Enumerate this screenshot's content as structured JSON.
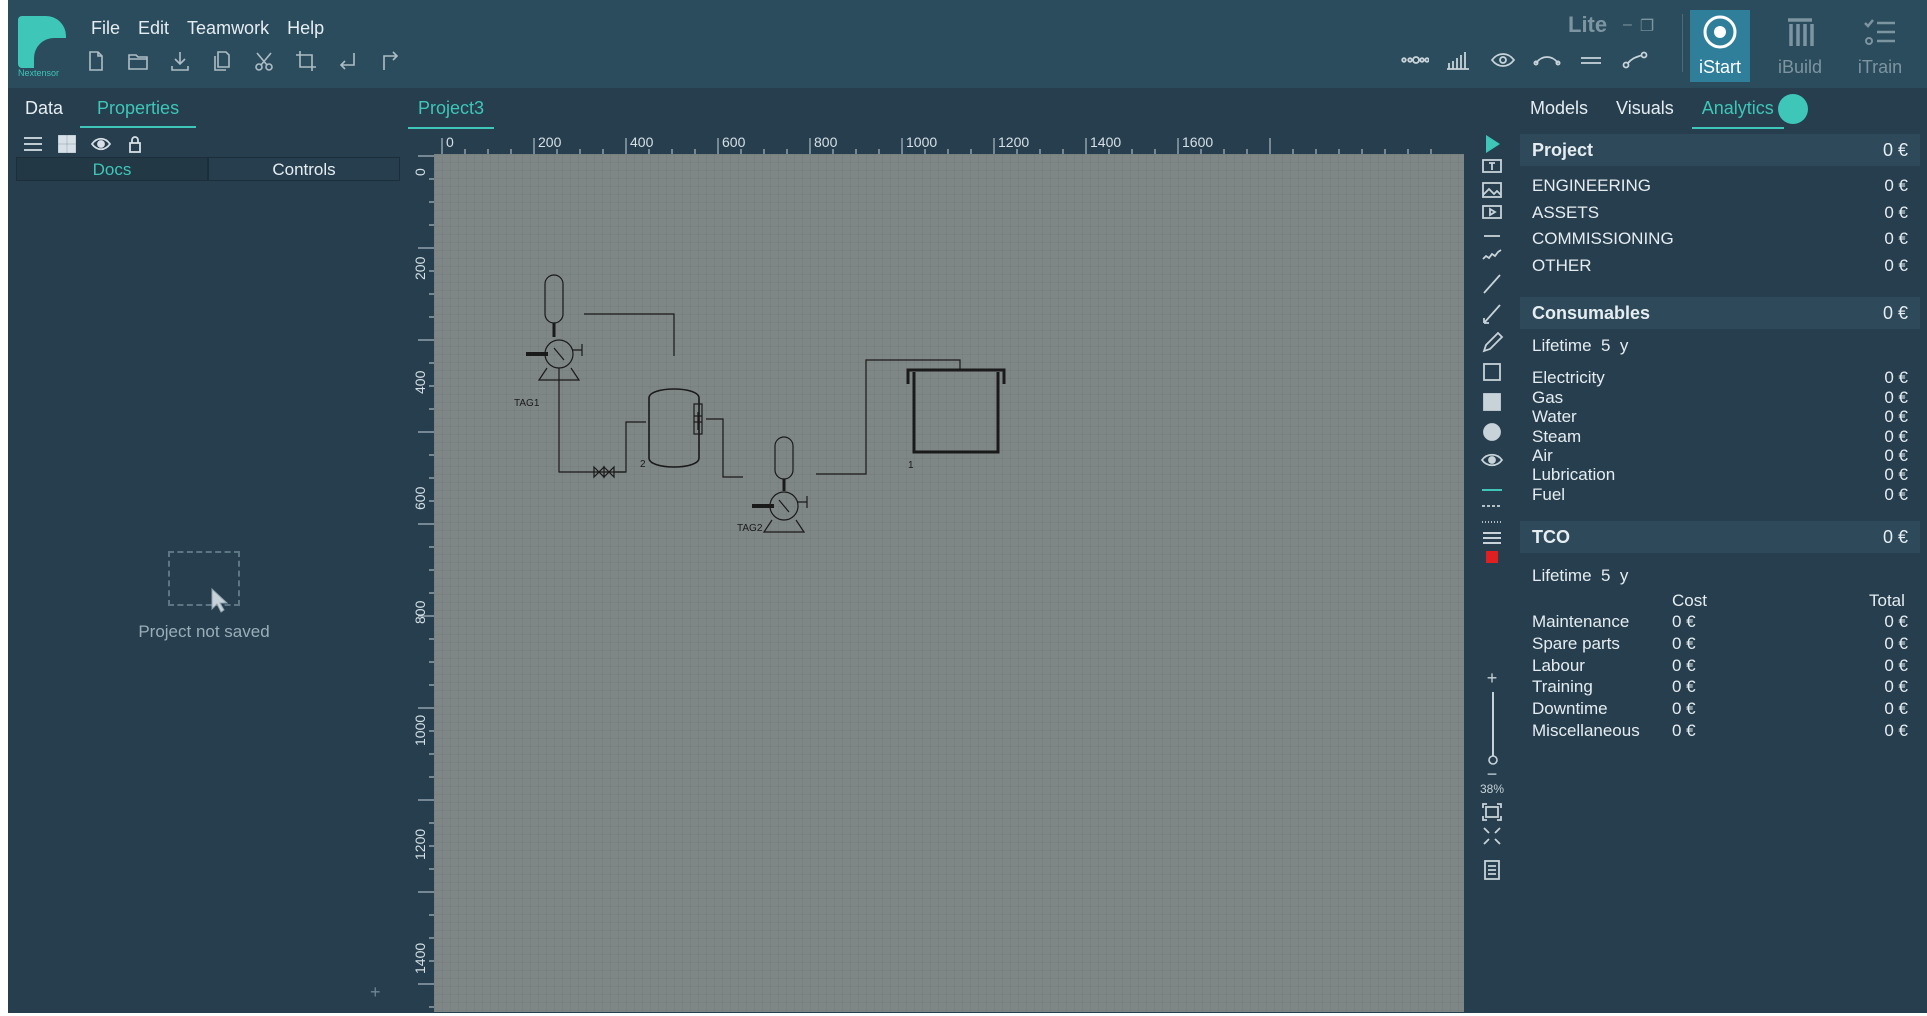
{
  "app": {
    "logo_text": "Nextensor",
    "edition": "Lite"
  },
  "menu": [
    "File",
    "Edit",
    "Teamwork",
    "Help"
  ],
  "toolbar": [
    "new-file-icon",
    "open-folder-icon",
    "download-icon",
    "copy-icon",
    "cut-icon",
    "crop-icon",
    "undo-icon",
    "redo-icon"
  ],
  "modes": [
    {
      "label": "iStart",
      "active": true
    },
    {
      "label": "iBuild",
      "active": false
    },
    {
      "label": "iTrain",
      "active": false
    }
  ],
  "left": {
    "tabs": [
      "Data",
      "Properties"
    ],
    "active_tab": "Properties",
    "subtabs": [
      "Docs",
      "Controls"
    ],
    "empty_text": "Project not saved",
    "plus": "+"
  },
  "center": {
    "doc_tab": "Project3",
    "ruler_top": [
      "0",
      "200",
      "400",
      "600",
      "800",
      "1000",
      "1200",
      "1400",
      "1600"
    ],
    "ruler_left": [
      "0",
      "200",
      "400",
      "600",
      "800",
      "1000",
      "1200",
      "1400"
    ],
    "diagram_labels": {
      "tag1": "TAG1",
      "tag2": "TAG2",
      "num2": "2",
      "num1": "1"
    },
    "zoom": "38%",
    "zoom_plus": "+",
    "zoom_minus": "−"
  },
  "right": {
    "tabs": [
      "Models",
      "Visuals",
      "Analytics"
    ],
    "active_tab": "Analytics",
    "project": {
      "title": "Project",
      "amount": "0 €",
      "rows": [
        {
          "label": "ENGINEERING",
          "amount": "0 €"
        },
        {
          "label": "ASSETS",
          "amount": "0 €"
        },
        {
          "label": "COMMISSIONING",
          "amount": "0 €"
        },
        {
          "label": "OTHER",
          "amount": "0 €"
        }
      ]
    },
    "consumables": {
      "title": "Consumables",
      "amount": "0 €",
      "lifetime": "Lifetime  5  y",
      "rows": [
        {
          "label": "Electricity",
          "amount": "0 €"
        },
        {
          "label": "Gas",
          "amount": "0 €"
        },
        {
          "label": "Water",
          "amount": "0 €"
        },
        {
          "label": "Steam",
          "amount": "0 €"
        },
        {
          "label": "Air",
          "amount": "0 €"
        },
        {
          "label": "Lubrication",
          "amount": "0 €"
        },
        {
          "label": "Fuel",
          "amount": "0 €"
        }
      ]
    },
    "tco": {
      "title": "TCO",
      "amount": "0 €",
      "lifetime": "Lifetime  5  y",
      "col_cost": "Cost",
      "col_total": "Total",
      "rows": [
        {
          "label": "Maintenance",
          "cost": "0 €",
          "total": "0 €"
        },
        {
          "label": "Spare parts",
          "cost": "0 €",
          "total": "0 €"
        },
        {
          "label": "Labour",
          "cost": "0 €",
          "total": "0 €"
        },
        {
          "label": "Training",
          "cost": "0 €",
          "total": "0 €"
        },
        {
          "label": "Downtime",
          "cost": "0 €",
          "total": "0 €"
        },
        {
          "label": "Miscellaneous",
          "cost": "0 €",
          "total": "0 €"
        }
      ]
    }
  },
  "colors": {
    "accent": "#3ec6b8",
    "header": "#2b4c5d",
    "panel": "#263e4d",
    "canvas": "#7f8686",
    "active_mode": "#2f7e9a",
    "red_swatch": "#e02020"
  }
}
